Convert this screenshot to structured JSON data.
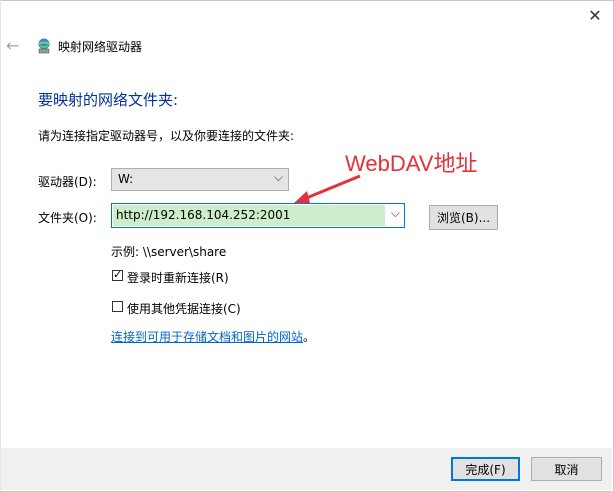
{
  "window": {
    "title": "映射网络驱动器",
    "close_glyph": "✕",
    "back_glyph": "←"
  },
  "content": {
    "heading": "要映射的网络文件夹:",
    "instruction": "请为连接指定驱动器号，以及你要连接的文件夹:",
    "drive_label": "驱动器(D):",
    "drive_value": "W:",
    "folder_label": "文件夹(O):",
    "folder_value": "http://192.168.104.252:2001",
    "browse_button": "浏览(B)...",
    "example_text": "示例: \\\\server\\share",
    "reconnect_label": "登录时重新连接(R)",
    "reconnect_checked": true,
    "credentials_label": "使用其他凭据连接(C)",
    "credentials_checked": false,
    "link_text": "连接到可用于存储文档和图片的网站",
    "link_suffix": "。"
  },
  "footer": {
    "finish_button": "完成(F)",
    "cancel_button": "取消"
  },
  "annotation": {
    "text": "WebDAV地址",
    "color": "#e3323a"
  },
  "colors": {
    "heading": "#003399",
    "accent": "#0078d7",
    "link": "#0066cc",
    "selection": "#cdeecb"
  }
}
